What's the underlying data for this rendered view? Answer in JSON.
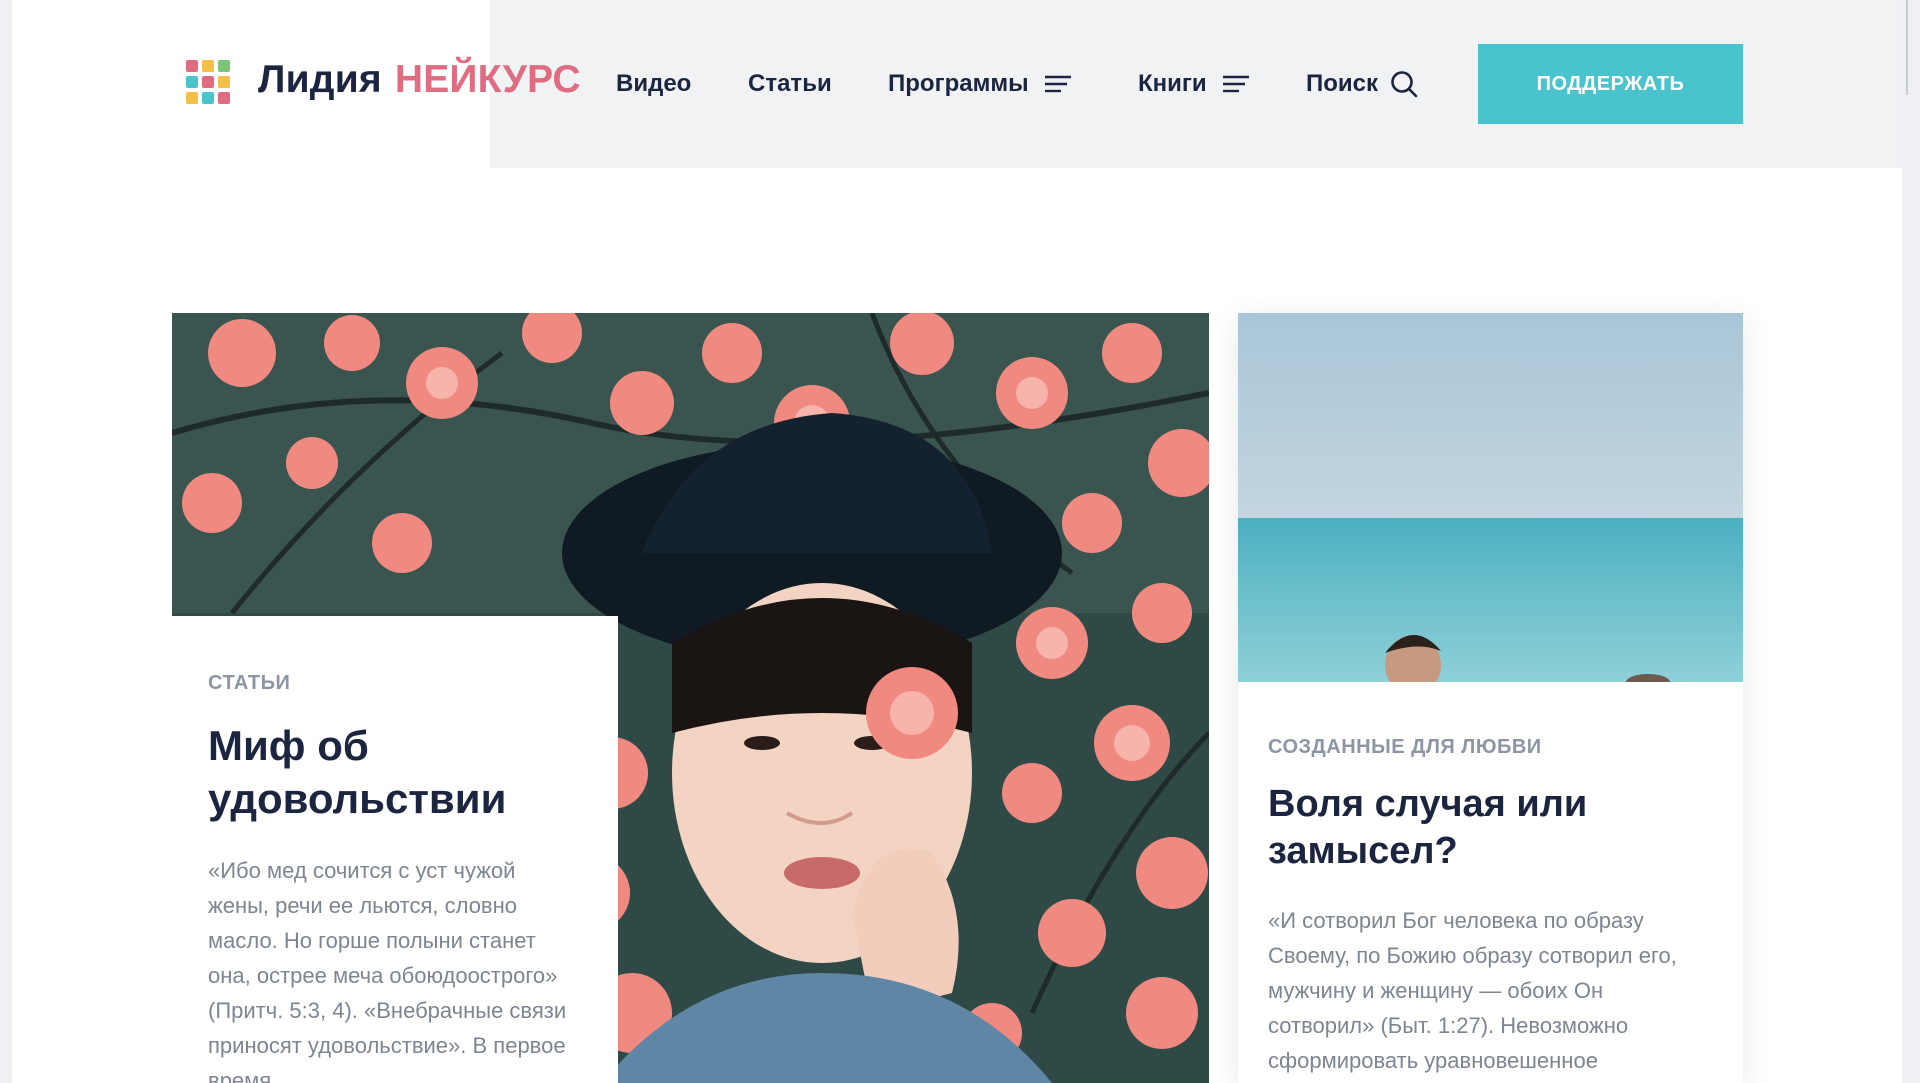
{
  "brand": {
    "first": "Лидия",
    "second": "НЕЙКУРС"
  },
  "nav": {
    "video": "Видео",
    "articles": "Статьи",
    "programs": "Программы",
    "books": "Книги",
    "search": "Поиск"
  },
  "support_button": "ПОДДЕРЖАТЬ",
  "cards": [
    {
      "category": "СТАТЬИ",
      "title": "Миф об удовольствии",
      "excerpt": "«Ибо мед сочится с уст чужой жены, речи ее льются, словно масло. Но горше полыни станет она, острее меча обоюдоострого» (Притч. 5:3, 4). «Внебрачные связи приносят удовольствие». В первое время"
    },
    {
      "category": "СОЗДАННЫЕ ДЛЯ ЛЮБВИ",
      "title": "Воля случая или замысел?",
      "excerpt": "«И сотворил Бог человека по образу Своему, по Божию образу сотворил его, мужчину и женщину — обоих Он сотворил» (Быт. 1:27). Невозможно сформировать уравновешенное представление о сексуальности"
    }
  ],
  "colors": {
    "accent": "#49c4cd",
    "brand_pink": "#e06c82",
    "heading": "#1b2540",
    "muted": "#8c95a3",
    "header_bg": "#f1f2f4"
  },
  "icons": [
    "logo-grid-icon",
    "menu-lines-icon",
    "search-icon"
  ]
}
